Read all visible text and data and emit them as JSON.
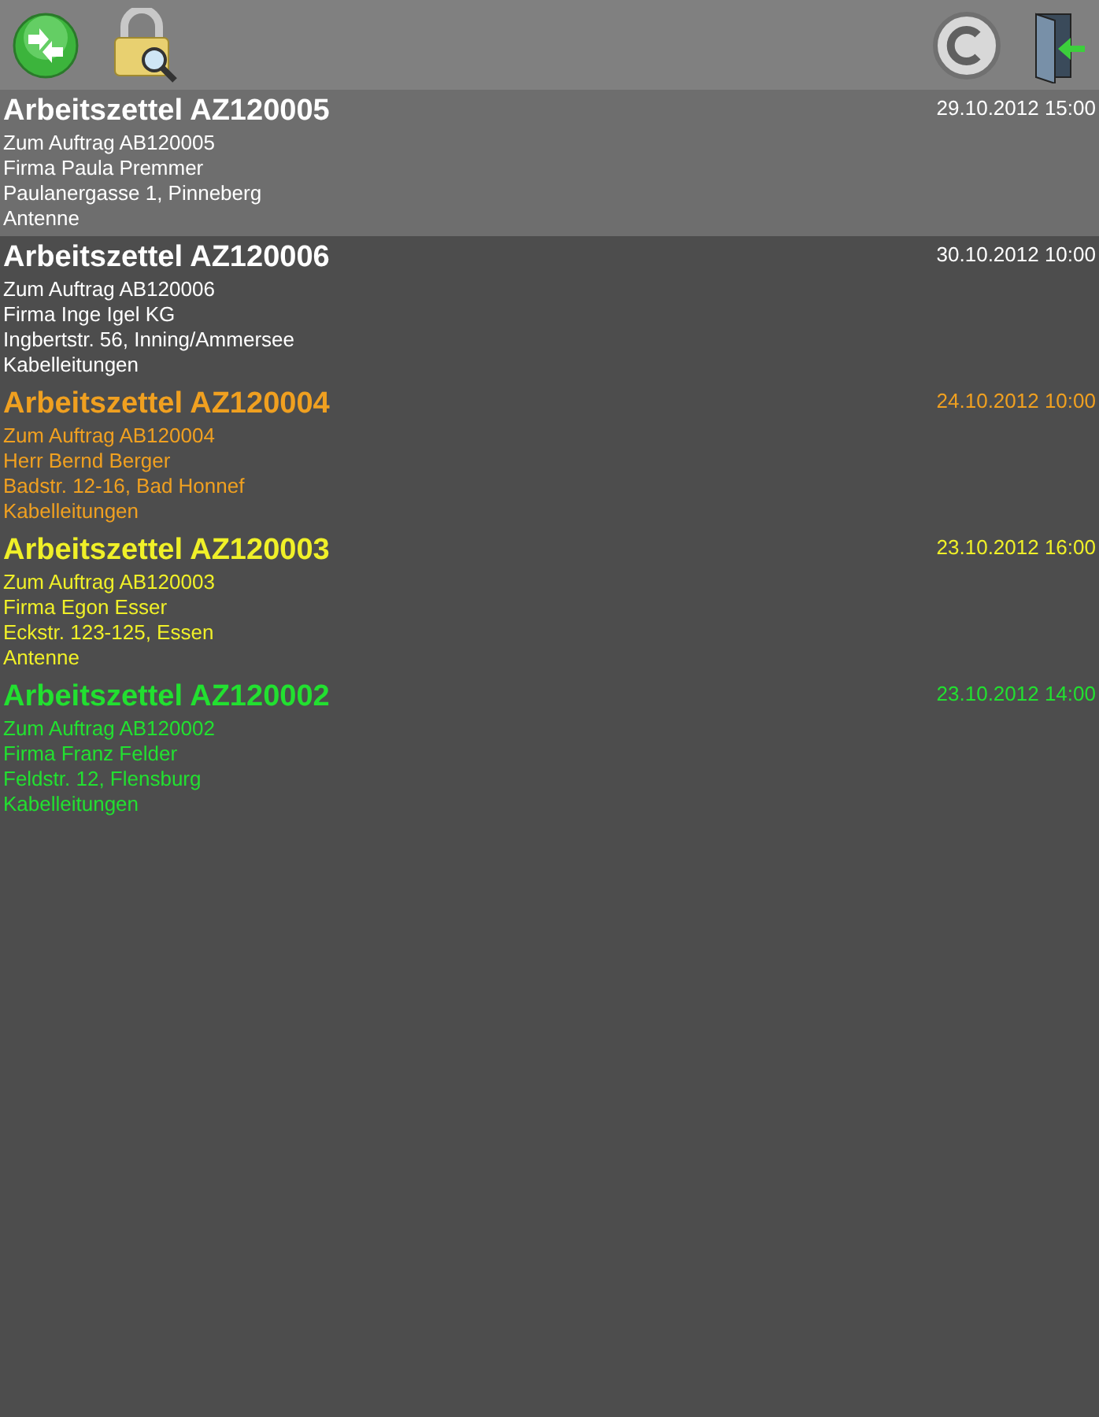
{
  "work_orders": [
    {
      "title": "Arbeitszettel AZ120005",
      "date": "29.10.2012 15:00",
      "lines": [
        "Zum Auftrag AB120005",
        "Firma Paula Premmer",
        "Paulanergasse 1, Pinneberg",
        "Antenne"
      ],
      "color": "#ffffff",
      "selected": true
    },
    {
      "title": "Arbeitszettel AZ120006",
      "date": "30.10.2012 10:00",
      "lines": [
        "Zum Auftrag AB120006",
        "Firma Inge Igel KG",
        "Ingbertstr. 56, Inning/Ammersee",
        "Kabelleitungen"
      ],
      "color": "#ffffff",
      "selected": false
    },
    {
      "title": "Arbeitszettel AZ120004",
      "date": "24.10.2012 10:00",
      "lines": [
        "Zum Auftrag AB120004",
        "Herr Bernd Berger",
        "Badstr. 12-16, Bad Honnef",
        "Kabelleitungen"
      ],
      "color": "#f0a020",
      "selected": false
    },
    {
      "title": "Arbeitszettel AZ120003",
      "date": "23.10.2012 16:00",
      "lines": [
        "Zum Auftrag AB120003",
        "Firma Egon Esser",
        "Eckstr. 123-125, Essen",
        "Antenne"
      ],
      "color": "#f0f028",
      "selected": false
    },
    {
      "title": "Arbeitszettel AZ120002",
      "date": "23.10.2012 14:00",
      "lines": [
        "Zum Auftrag AB120002",
        "Firma Franz Felder",
        "Feldstr. 12, Flensburg",
        "Kabelleitungen"
      ],
      "color": "#22e030",
      "selected": false
    }
  ]
}
